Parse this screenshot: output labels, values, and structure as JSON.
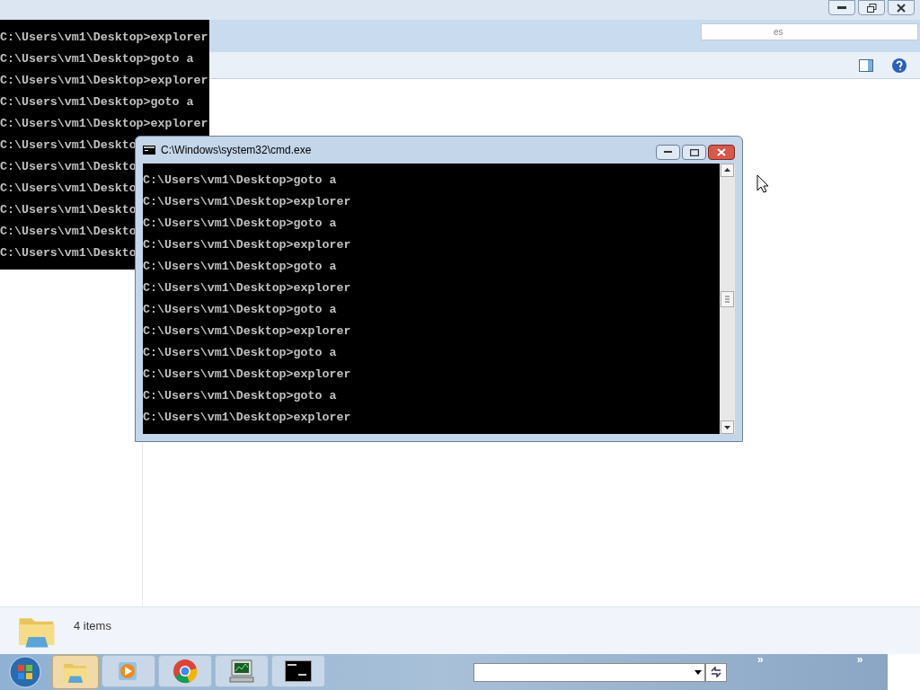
{
  "explorer": {
    "search": {
      "placeholder": "es"
    },
    "status_bar": {
      "text": "4 items"
    }
  },
  "back_console": {
    "lines": [
      "C:\\Users\\vm1\\Desktop>explorer",
      "C:\\Users\\vm1\\Desktop>goto a",
      "C:\\Users\\vm1\\Desktop>explorer",
      "C:\\Users\\vm1\\Desktop>goto a",
      "C:\\Users\\vm1\\Desktop>explorer",
      "C:\\Users\\vm1\\Deskto",
      "C:\\Users\\vm1\\Deskto",
      "C:\\Users\\vm1\\Deskto",
      "C:\\Users\\vm1\\Deskto",
      "C:\\Users\\vm1\\Deskto",
      "C:\\Users\\vm1\\Deskto"
    ]
  },
  "console_window": {
    "title": "C:\\Windows\\system32\\cmd.exe",
    "lines": [
      "C:\\Users\\vm1\\Desktop>goto a",
      "C:\\Users\\vm1\\Desktop>explorer",
      "C:\\Users\\vm1\\Desktop>goto a",
      "C:\\Users\\vm1\\Desktop>explorer",
      "C:\\Users\\vm1\\Desktop>goto a",
      "C:\\Users\\vm1\\Desktop>explorer",
      "C:\\Users\\vm1\\Desktop>goto a",
      "C:\\Users\\vm1\\Desktop>explorer",
      "C:\\Users\\vm1\\Desktop>goto a",
      "C:\\Users\\vm1\\Desktop>explorer",
      "C:\\Users\\vm1\\Desktop>goto a",
      "C:\\Users\\vm1\\Desktop>explorer"
    ]
  },
  "taskbar": {
    "apps": [
      {
        "kind": "explorer",
        "selected": true
      },
      {
        "kind": "media",
        "selected": false
      },
      {
        "kind": "chrome",
        "selected": false
      },
      {
        "kind": "network",
        "selected": false
      },
      {
        "kind": "console",
        "selected": false
      }
    ],
    "chevrons": [
      "»",
      "»"
    ]
  }
}
